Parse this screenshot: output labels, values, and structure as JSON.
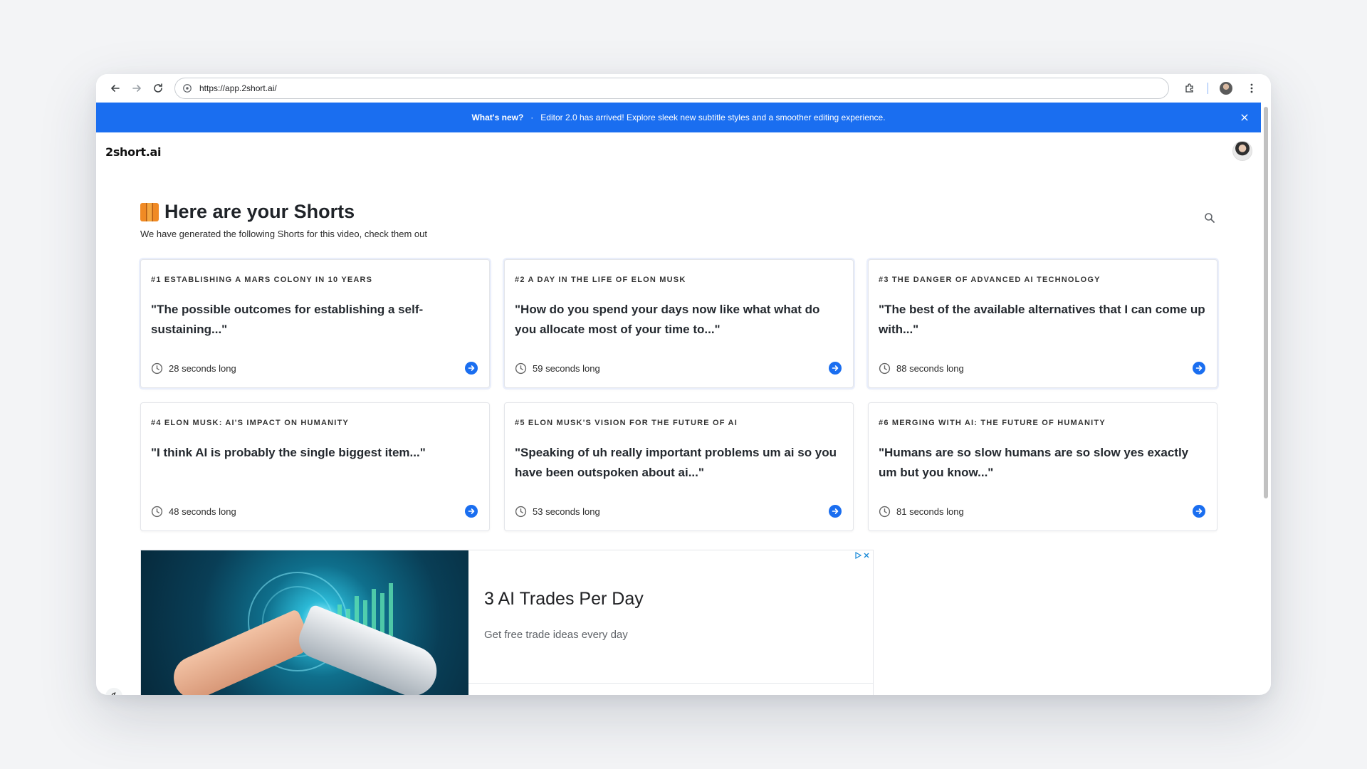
{
  "browser": {
    "url": "https://app.2short.ai/"
  },
  "banner": {
    "label": "What's new?",
    "separator": "·",
    "message": "Editor 2.0 has arrived! Explore sleek new subtitle styles and a smoother editing experience."
  },
  "header": {
    "logo": "2short.ai"
  },
  "main": {
    "title": "Here are your Shorts",
    "subtitle": "We have generated the following Shorts for this video, check them out"
  },
  "shorts": [
    {
      "tag": "#1 Establishing a Mars Colony in 10 Years",
      "quote": "\"The possible outcomes for establishing a self-sustaining...\"",
      "duration": "28 seconds long"
    },
    {
      "tag": "#2 A Day in the Life of Elon Musk",
      "quote": "\"How do you spend your days now like what what do you allocate most of your time to...\"",
      "duration": "59 seconds long"
    },
    {
      "tag": "#3 The Danger of Advanced AI Technology",
      "quote": "\"The best of the available alternatives that I can come up with...\"",
      "duration": "88 seconds long"
    },
    {
      "tag": "#4 Elon Musk: AI's Impact on Humanity",
      "quote": "\"I think AI is probably the single biggest item...\"",
      "duration": "48 seconds long"
    },
    {
      "tag": "#5 Elon Musk's Vision for the Future of AI",
      "quote": "\"Speaking of uh really important problems um ai so you have been outspoken about ai...\"",
      "duration": "53 seconds long"
    },
    {
      "tag": "#6 Merging with AI: The Future of Humanity",
      "quote": "\"Humans are so slow humans are so slow yes exactly um but you know...\"",
      "duration": "81 seconds long"
    }
  ],
  "ad": {
    "title": "3 AI Trades Per Day",
    "description": "Get free trade ideas every day"
  },
  "colors": {
    "accent": "#1a6ef0",
    "background": "#f3f4f6"
  },
  "icons": {
    "back": "back-arrow-icon",
    "forward": "forward-arrow-icon",
    "reload": "reload-icon",
    "site-info": "site-info-icon",
    "extensions": "puzzle-icon",
    "menu": "kebab-menu-icon",
    "close": "close-icon",
    "search": "search-icon",
    "clock": "clock-icon",
    "go": "arrow-right-circle-icon",
    "theme": "moon-icon"
  }
}
